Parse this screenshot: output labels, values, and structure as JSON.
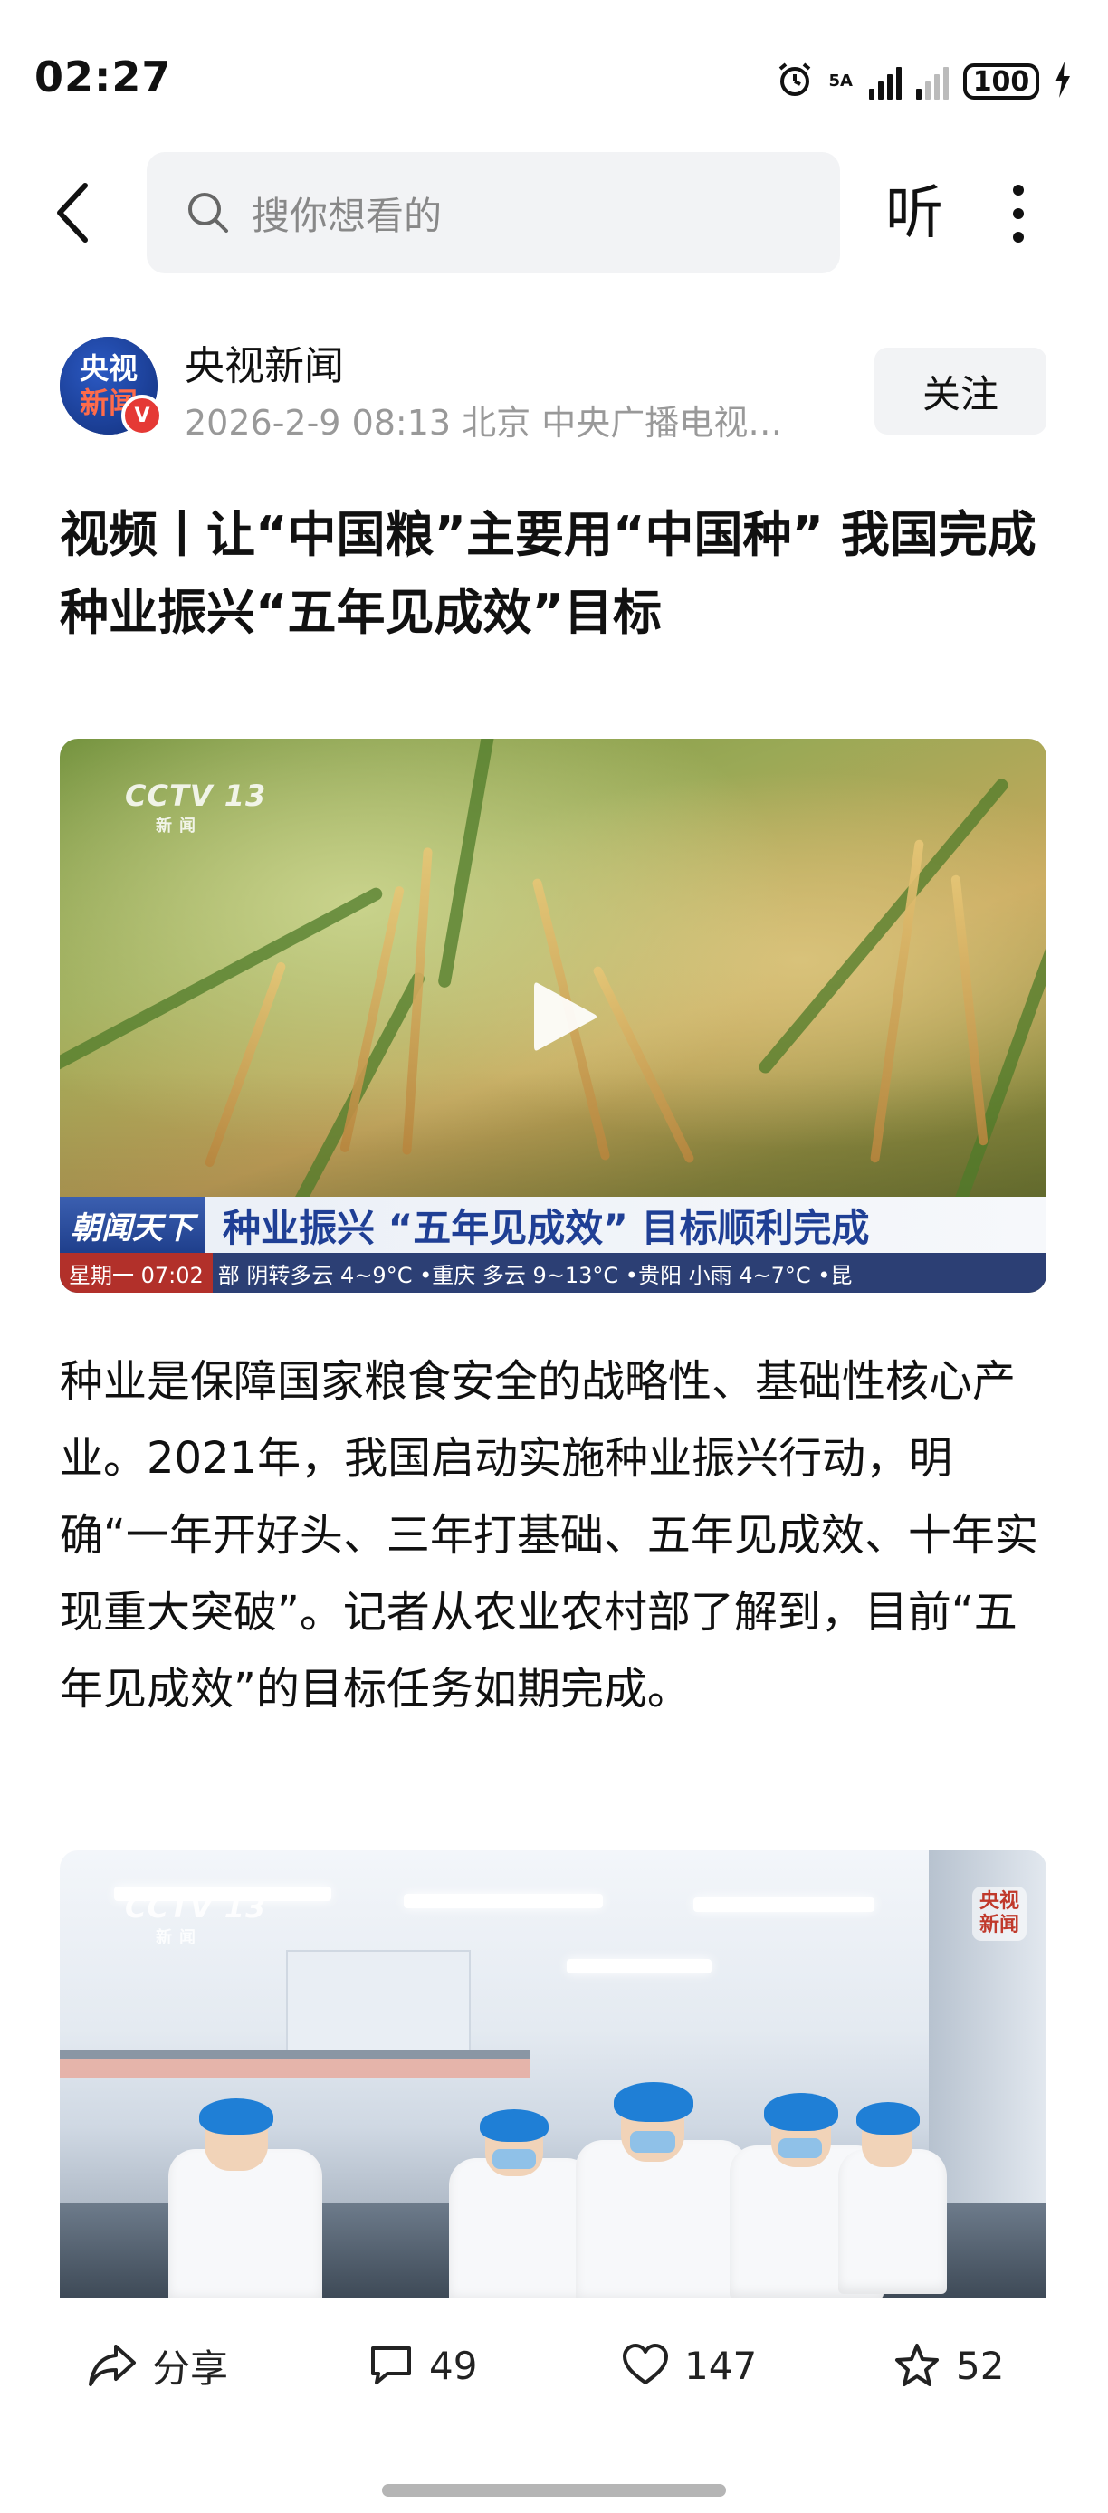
{
  "status_bar": {
    "time": "02:27",
    "network_label": "5A",
    "battery": "100"
  },
  "header": {
    "search_placeholder": "搜你想看的",
    "listen_label": "听"
  },
  "author": {
    "avatar_text_top": "央视",
    "avatar_text_bottom": "新闻",
    "verified_badge": "V",
    "name": "央视新闻",
    "meta": "2026-2-9  08:13  北京  中央广播电视…",
    "follow_label": "关注"
  },
  "article": {
    "title": "视频丨让“中国粮”主要用“中国种” 我国完成种业振兴“五年见成效”目标",
    "video": {
      "channel_logo": "CCTV 13",
      "channel_sub": "新闻",
      "program": "朝闻天下",
      "headline": "种业振兴 “五年见成效” 目标顺利完成",
      "ticker_day": "星期一  07:02",
      "ticker_text": "部 阴转多云 4~9°C  •重庆 多云 9~13°C  •贵阳 小雨 4~7°C  •昆"
    },
    "body": "种业是保障国家粮食安全的战略性、基础性核心产业。2021年，我国启动实施种业振兴行动，明确“一年开好头、三年打基础、五年见成效、十年实现重大突破”。记者从农业农村部了解到，目前“五年见成效”的目标任务如期完成。",
    "image2": {
      "channel_logo": "CCTV 13",
      "channel_sub": "新闻",
      "sticker": "央视新闻"
    }
  },
  "bottom_bar": {
    "share_label": "分享",
    "comments": "49",
    "likes": "147",
    "favorites": "52"
  }
}
